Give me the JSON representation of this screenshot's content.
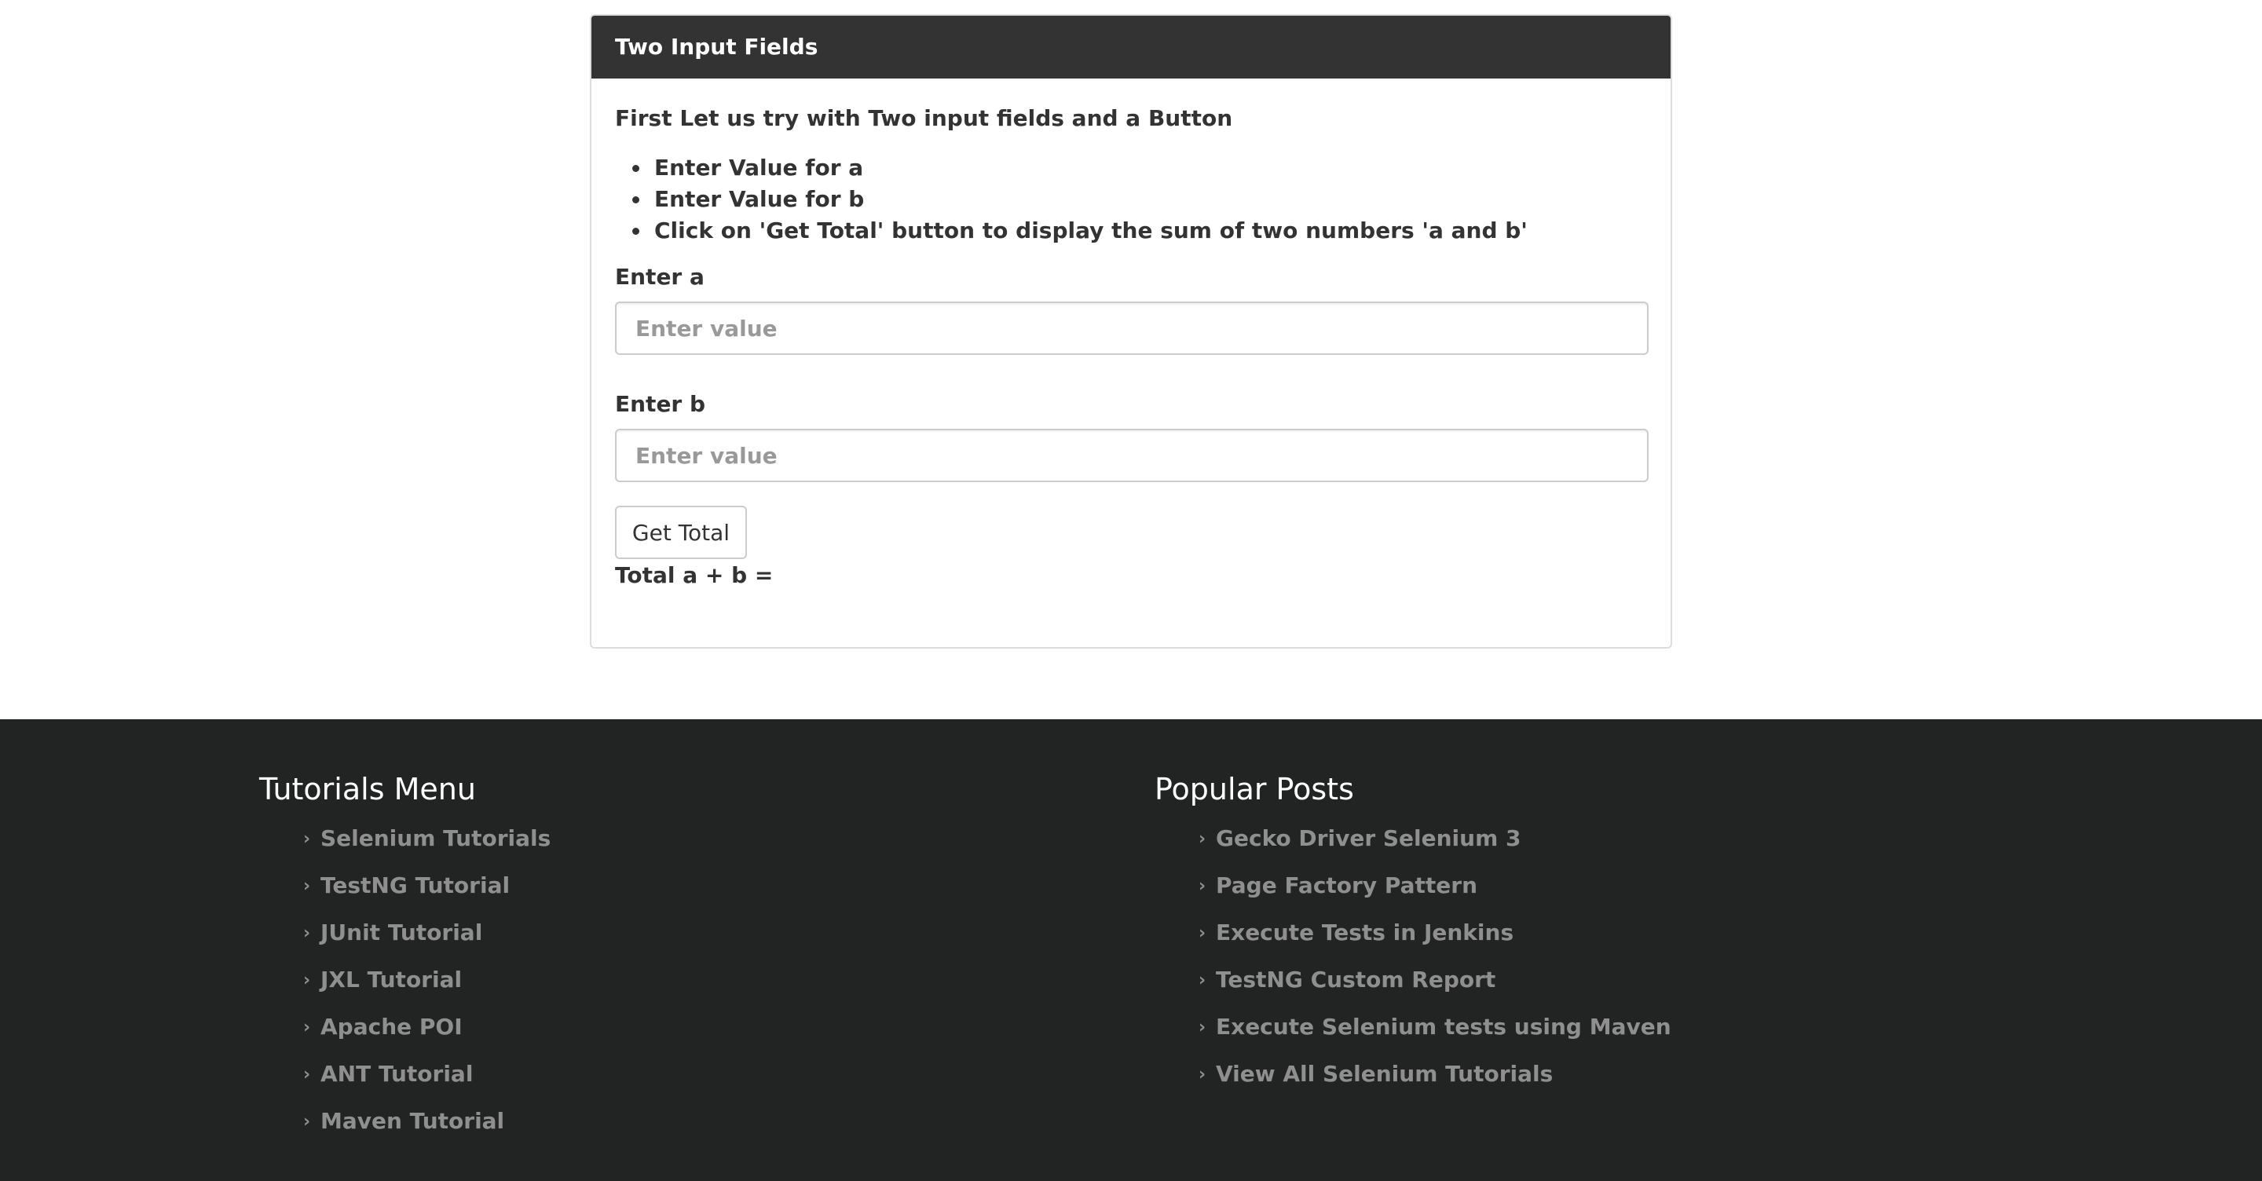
{
  "panel": {
    "heading": "Two Input Fields",
    "intro": "First Let us try with Two input fields and a Button",
    "steps": [
      "Enter Value for a",
      "Enter Value for b",
      "Click on 'Get Total' button to display the sum of two numbers 'a and b'"
    ],
    "field_a": {
      "label": "Enter a",
      "placeholder": "Enter value",
      "value": ""
    },
    "field_b": {
      "label": "Enter b",
      "placeholder": "Enter value",
      "value": ""
    },
    "button_label": "Get Total",
    "total_label": "Total a + b ="
  },
  "footer": {
    "tutorials": {
      "title": "Tutorials Menu",
      "items": [
        "Selenium Tutorials",
        "TestNG Tutorial",
        "JUnit Tutorial",
        "JXL Tutorial",
        "Apache POI",
        "ANT Tutorial",
        "Maven Tutorial"
      ]
    },
    "popular": {
      "title": "Popular Posts",
      "items": [
        "Gecko Driver Selenium 3",
        "Page Factory Pattern",
        "Execute Tests in Jenkins",
        "TestNG Custom Report",
        "Execute Selenium tests using Maven",
        "View All Selenium Tutorials"
      ]
    },
    "bullet_icon": "chevron-right-icon"
  },
  "colors": {
    "panel_heading_bg": "#333333",
    "footer_bg": "#222423",
    "footer_link": "#8f8f8f"
  }
}
